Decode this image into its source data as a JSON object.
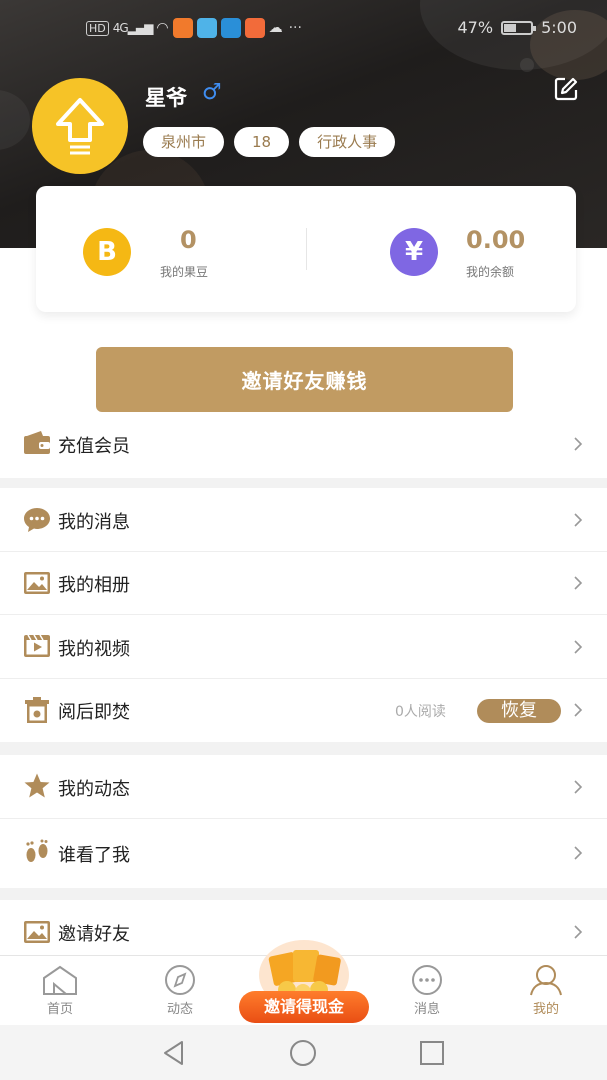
{
  "status_bar": {
    "battery": "47%",
    "time": "5:00",
    "network": "4G",
    "hd": "HD"
  },
  "profile": {
    "name": "星爷",
    "gender_symbol": "♂",
    "tags": [
      "泉州市",
      "18",
      "行政人事"
    ]
  },
  "wallet": {
    "beans_value": "0",
    "beans_label": "我的果豆",
    "beans_symbol": "B",
    "balance_value": "0.00",
    "balance_label": "我的余额",
    "balance_symbol": "¥"
  },
  "invite_button": "邀请好友赚钱",
  "menu": {
    "recharge": "充值会员",
    "messages": "我的消息",
    "album": "我的相册",
    "videos": "我的视频",
    "burn": "阅后即焚",
    "burn_readers": "0人阅读",
    "burn_restore": "恢复",
    "moments": "我的动态",
    "visitors": "谁看了我",
    "invite": "邀请好友"
  },
  "tabbar": {
    "home": "首页",
    "feed": "动态",
    "promo": "邀请得现金",
    "messages": "消息",
    "me": "我的"
  },
  "colors": {
    "accent": "#c19b62",
    "accent_dark": "#b08c5a",
    "avatar": "#f6c327",
    "coin_b": "#f5b814",
    "coin_yen": "#7f67e3",
    "gender": "#3f8df0",
    "promo": "#e94e14"
  },
  "icons": [
    "edit-icon",
    "chevron-right-icon",
    "wallet-icon",
    "chat-bubble-icon",
    "image-icon",
    "video-icon",
    "trash-icon",
    "star-icon",
    "footprint-icon",
    "home-icon",
    "compass-icon",
    "message-icon",
    "user-icon"
  ]
}
